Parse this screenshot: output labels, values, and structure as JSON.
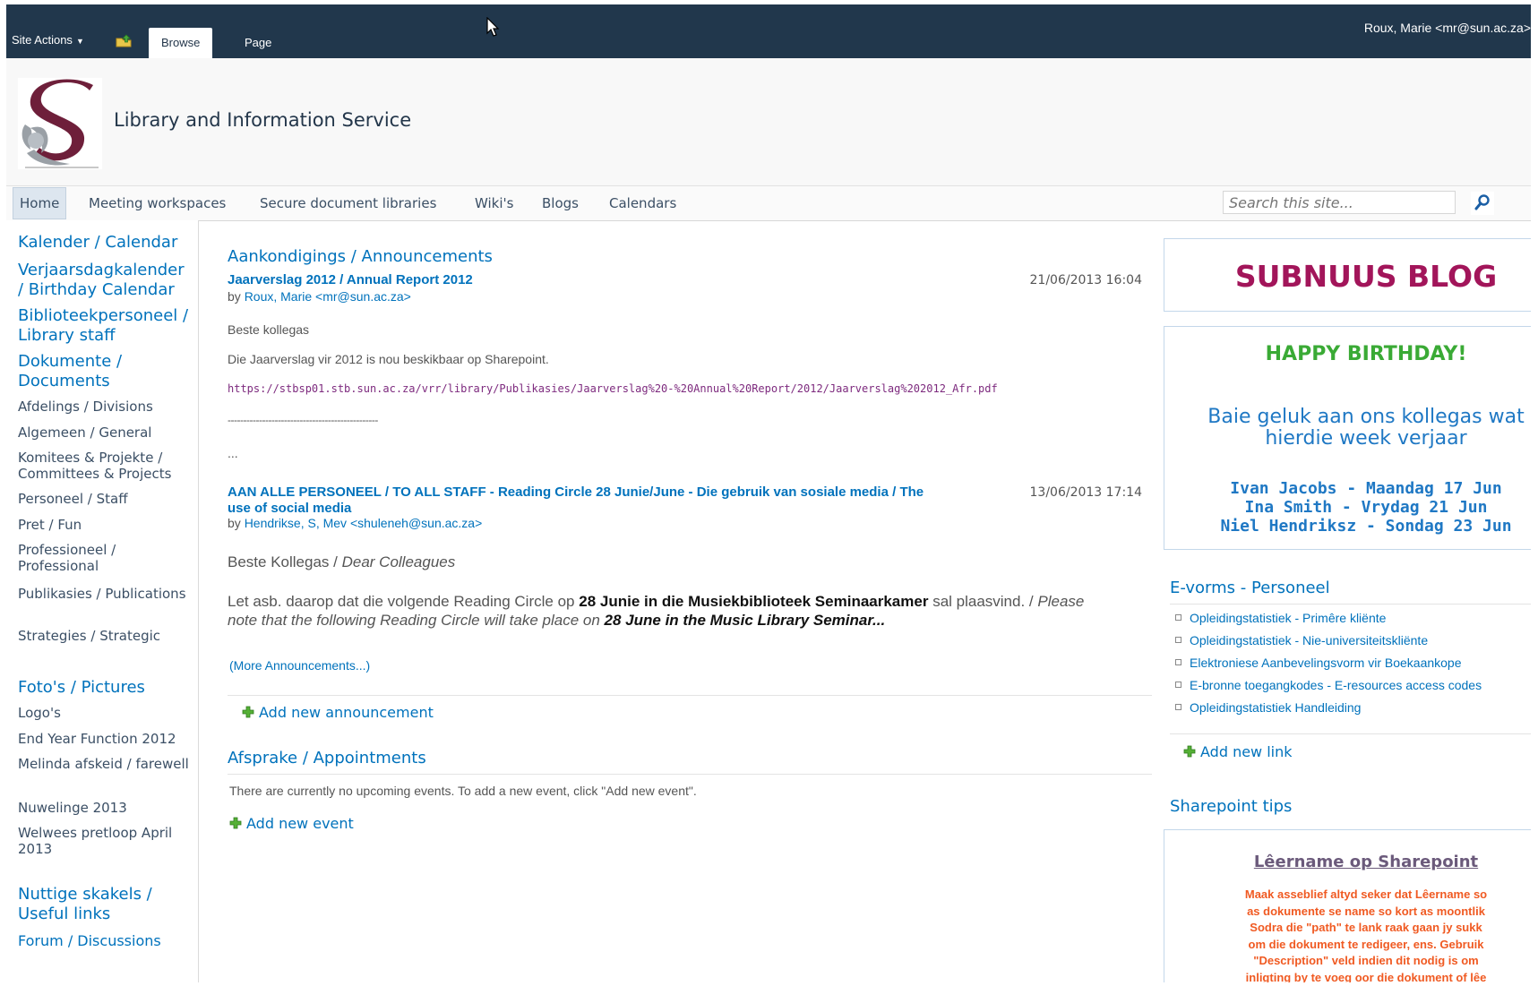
{
  "ribbon": {
    "site_actions": "Site Actions",
    "tabs": [
      "Browse",
      "Page"
    ],
    "user": "Roux, Marie <mr@sun.ac.za>"
  },
  "site": {
    "title": "Library and Information Service"
  },
  "topnav": {
    "items": [
      "Home",
      "Meeting workspaces",
      "Secure document libraries",
      "Wiki's",
      "Blogs",
      "Calendars"
    ],
    "search_placeholder": "Search this site..."
  },
  "quicklaunch": {
    "items": [
      "Kalender / Calendar",
      "Verjaarsdagkalender / Birthday Calendar",
      "Biblioteekpersoneel / Library staff",
      "Dokumente / Documents",
      "Afdelings / Divisions",
      "Algemeen / General",
      "Komitees & Projekte / Committees & Projects",
      "Personeel / Staff",
      "Pret / Fun",
      "Professioneel / Professional",
      "Publikasies / Publications",
      "Strategies / Strategic",
      "Foto's / Pictures",
      "Logo's",
      "End Year Function 2012",
      "Melinda afskeid / farewell",
      "Nuwelinge 2013",
      "Welwees pretloop April 2013",
      "Nuttige skakels / Useful links",
      "Forum / Discussions"
    ]
  },
  "announcements": {
    "title": "Aankondigings / Announcements",
    "items": [
      {
        "title": "Jaarverslag 2012 / Annual Report 2012",
        "date": "21/06/2013 16:04",
        "by": "by",
        "author": "Roux, Marie <mr@sun.ac.za>",
        "greeting": "Beste kollegas",
        "body": "Die Jaarverslag vir 2012 is nou beskikbaar op Sharepoint.",
        "link": "https://stbsp01.stb.sun.ac.za/vrr/library/Publikasies/Jaarverslag%20-%20Annual%20Report/2012/Jaarverslag%202012_Afr.pdf",
        "separator": "------------------------------------------------",
        "ellipsis": "..."
      },
      {
        "title_line1": "AAN ALLE PERSONEEL / TO ALL STAFF - Reading Circle 28 Junie/June - Die gebruik van sosiale media / The",
        "title_line2": "use of social media",
        "date": "13/06/2013 17:14",
        "by": "by",
        "author": "Hendrikse, S, Mev <shuleneh@sun.ac.za>",
        "greeting": "Beste Kollegas /",
        "greeting_en": "Dear Colleagues",
        "body_a": "Let asb. daarop dat die volgende Reading Circle op",
        "body_b": "28 Junie in die Musiekbiblioteek Seminaarkamer",
        "body_c": "sal plaasvind. /",
        "body_d": "Please",
        "body_e": "note that the following Reading Circle will take place on",
        "body_f": "28 June in the Music Library Seminar..."
      }
    ],
    "more": "(More Announcements...)",
    "add_new": "Add new announcement"
  },
  "appointments": {
    "title": "Afsprake / Appointments",
    "empty": "There are currently no upcoming events. To add a new event, click \"Add new event\".",
    "add_new": "Add new event"
  },
  "blog": {
    "title": "SUBNUUS BLOG"
  },
  "birthday": {
    "title": "HAPPY BIRTHDAY!",
    "message_line1": "Baie geluk aan ons kollegas wat",
    "message_line2": "hierdie week verjaar",
    "names": [
      "Ivan Jacobs - Maandag 17 Jun",
      "Ina Smith - Vrydag 21 Jun",
      "Niel Hendriksz - Sondag 23 Jun"
    ]
  },
  "eforms": {
    "title": "E-vorms - Personeel",
    "links": [
      "Opleidingstatistiek - Primêre kliënte",
      "Opleidingstatistiek - Nie-universiteitskliënte",
      "Elektroniese Aanbevelingsvorm vir Boekaankope",
      "E-bronne toegangkodes - E-resources access codes",
      "Opleidingstatistiek Handleiding"
    ],
    "add_new": "Add new link"
  },
  "tips": {
    "title": "Sharepoint tips",
    "heading": "Lêername op Sharepoint",
    "lines": [
      "Maak asseblief altyd seker dat Lêername so",
      "as dokumente se name so kort as moontlik",
      "Sodra die \"path\" te lank raak gaan jy sukk",
      "om die dokument te redigeer, ens. Gebruik",
      "\"Description\" veld indien dit nodig is om",
      "inligting by te voeg oor die dokument of lêe"
    ]
  },
  "colors": {
    "ribbon": "#21374c",
    "link_blue": "#0072bc",
    "blog_magenta": "#a2155a",
    "birthday_green": "#3aaa35",
    "tips_orange": "#f05a22"
  }
}
